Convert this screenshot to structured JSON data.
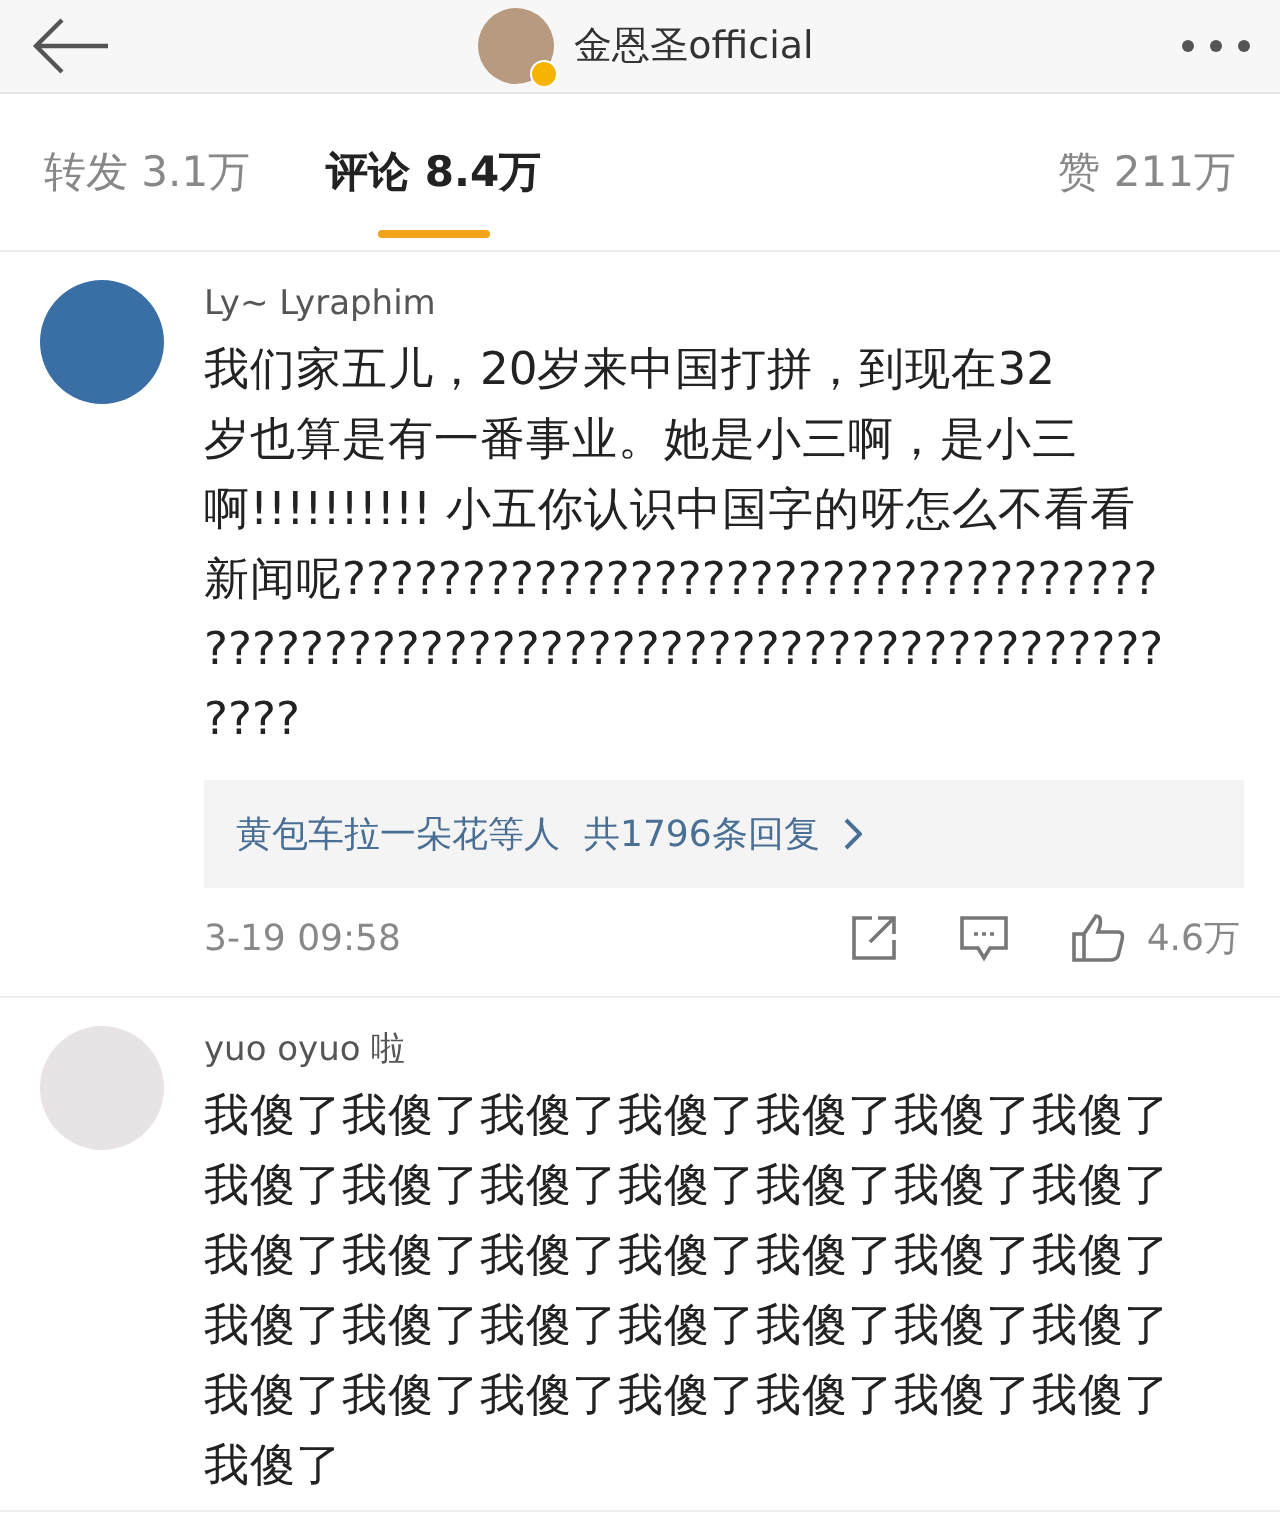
{
  "header": {
    "account_name": "金恩圣official",
    "verified": true
  },
  "tabs": [
    {
      "label": "转发 3.1万",
      "selected": false
    },
    {
      "label": "评论 8.4万",
      "selected": true
    },
    {
      "label": "赞 211万",
      "selected": false
    }
  ],
  "comments": [
    {
      "username": "Ly~ Lyraphim",
      "lines": [
        "我们家五儿，20岁来中国打拼，到现在32",
        "岁也算是有一番事业。她是小三啊，是小三",
        "啊!!!!!!!!!! 小五你认识中国字的呀怎么不看看",
        "新闻呢??????????????????????????????????",
        "????????????????????????????????????????",
        "????"
      ],
      "replies": {
        "names": "黄包车拉一朵花等人",
        "count": "共1796条回复"
      },
      "time": "3-19 09:58",
      "likes": "4.6万"
    },
    {
      "username": "yuo oyuo 啦",
      "lines": [
        "我傻了我傻了我傻了我傻了我傻了我傻了我傻了",
        "我傻了我傻了我傻了我傻了我傻了我傻了我傻了",
        "我傻了我傻了我傻了我傻了我傻了我傻了我傻了",
        "我傻了我傻了我傻了我傻了我傻了我傻了我傻了",
        "我傻了我傻了我傻了我傻了我傻了我傻了我傻了",
        "我傻了"
      ]
    }
  ]
}
